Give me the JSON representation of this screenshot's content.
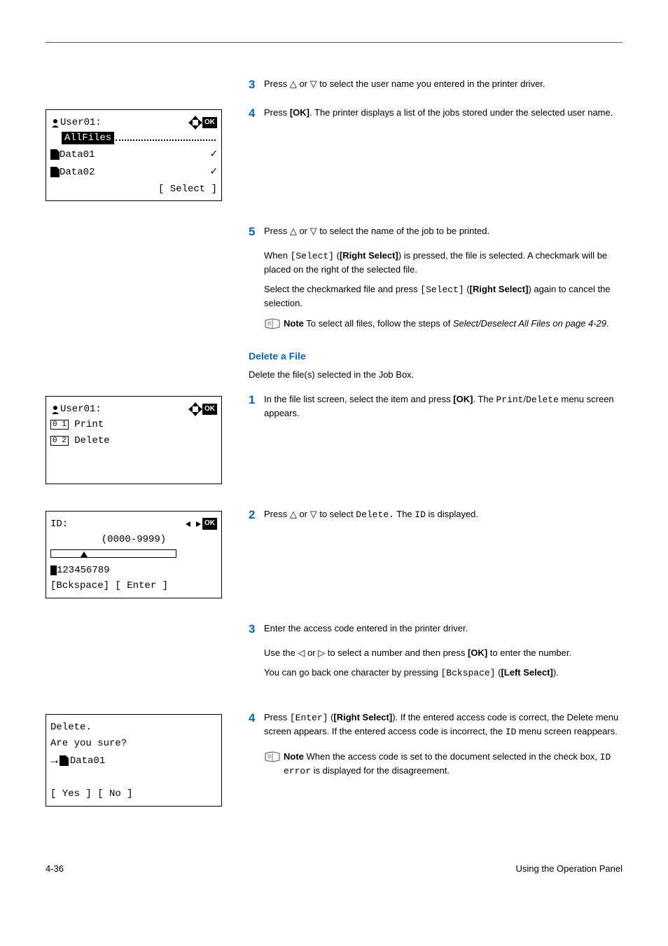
{
  "steps": {
    "s3": "Press △ or ▽ to select the user name you entered in the printer driver.",
    "s4_a": "Press ",
    "s4_b": "[OK]",
    "s4_c": ". The printer displays a list of the jobs stored under the selected user name.",
    "s5": "Press △ or ▽ to select the name of the job to be printed.",
    "s5_p1_a": "When ",
    "s5_p1_b": "[Select]",
    "s5_p1_c": " (",
    "s5_p1_d": "[Right Select]",
    "s5_p1_e": ") is pressed, the file is selected. A checkmark will be placed on the right of the selected file.",
    "s5_p2_a": "Select the checkmarked file and press ",
    "s5_p2_b": "[Select]",
    "s5_p2_c": " (",
    "s5_p2_d": "[Right Select]",
    "s5_p2_e": ") again to cancel the selection.",
    "note1_a": "Note",
    "note1_b": "  To select all files, follow the steps of ",
    "note1_c": "Select/Deselect All Files on page 4-29",
    "note1_d": "."
  },
  "delete": {
    "heading": "Delete a File",
    "intro": "Delete the file(s) selected in the Job Box.",
    "s1_a": "In the file list screen, select the item and press ",
    "s1_b": "[OK]",
    "s1_c": ". The ",
    "s1_d": "Print",
    "s1_e": "/",
    "s1_f": "Delete",
    "s1_g": " menu screen appears.",
    "s2_a": "Press △ or ▽ to select ",
    "s2_b": "Delete.",
    "s2_c": "  The ",
    "s2_d": "ID",
    "s2_e": " is displayed.",
    "s3": "Enter the access code entered in the printer driver.",
    "s3_p1_a": "Use the ◁ or ▷ to select a number and then press ",
    "s3_p1_b": "[OK]",
    "s3_p1_c": " to enter the number.",
    "s3_p2_a": "You can go back one character by pressing ",
    "s3_p2_b": "[Bckspace]",
    "s3_p2_c": " (",
    "s3_p2_d": "[Left Select]",
    "s3_p2_e": ").",
    "s4_a": "Press ",
    "s4_b": "[Enter]",
    "s4_c": " (",
    "s4_d": "[Right Select]",
    "s4_e": "). If the entered access code is correct, the Delete menu screen appears. If the entered access code is incorrect, the ",
    "s4_f": "ID",
    "s4_g": " menu screen reappears.",
    "note2_a": "Note",
    "note2_b": "  When the access code is set to the document selected in the check box, ",
    "note2_c": "ID error",
    "note2_d": " is displayed for the disagreement."
  },
  "screens": {
    "s1_title": "User01:",
    "s1_row_sel": "AllFiles",
    "s1_row2": "Data01",
    "s1_row3": "Data02",
    "s1_softkey": "[ Select  ]",
    "s2_title": "User01:",
    "s2_row1": "Print",
    "s2_row2": "Delete",
    "s3_title": "ID:",
    "s3_range": "(0000-9999)",
    "s3_digits": "123456789",
    "s3_softkeys": "[Bckspace] [ Enter  ]",
    "s4_l1": "Delete.",
    "s4_l2": "Are you sure?",
    "s4_l3": "Data01",
    "s4_softkeys": "[  Yes   ] [   No   ]"
  },
  "nums": {
    "n3": "3",
    "n4": "4",
    "n5": "5",
    "n1": "1",
    "n2": "2"
  },
  "boxnums": {
    "b01": "0 1",
    "b02": "0 2"
  },
  "footer": {
    "left": "4-36",
    "right": "Using the Operation Panel"
  }
}
